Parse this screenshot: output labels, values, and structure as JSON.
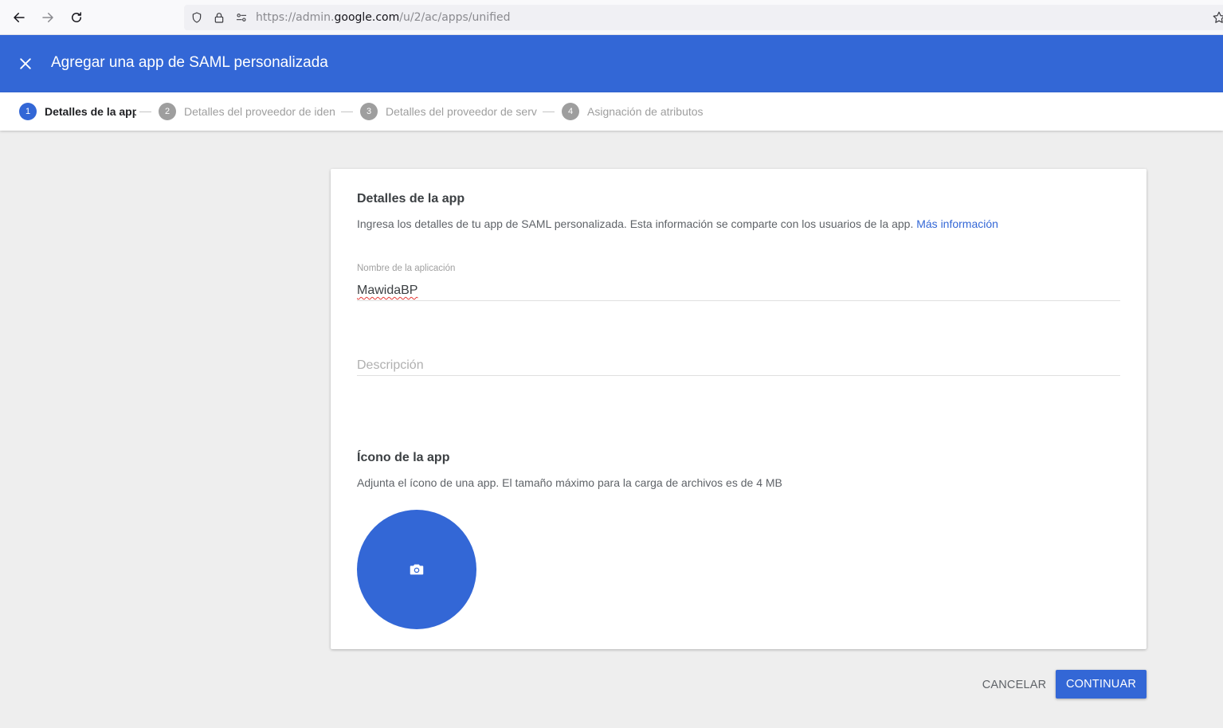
{
  "browser": {
    "url_prefix": "https://admin.",
    "url_domain": "google.com",
    "url_path": "/u/2/ac/apps/unified"
  },
  "header": {
    "title": "Agregar una app de SAML personalizada"
  },
  "stepper": {
    "steps": [
      {
        "num": "1",
        "label": "Detalles de la app",
        "active": true
      },
      {
        "num": "2",
        "label": "Detalles del proveedor de identidad",
        "active": false
      },
      {
        "num": "3",
        "label": "Detalles del proveedor de servicios",
        "active": false
      },
      {
        "num": "4",
        "label": "Asignación de atributos",
        "active": false
      }
    ]
  },
  "card": {
    "details_title": "Detalles de la app",
    "details_desc": "Ingresa los detalles de tu app de SAML personalizada. Esta información se comparte con los usuarios de la app.",
    "more_info_link": "Más información",
    "app_name_label": "Nombre de la aplicación",
    "app_name_value": "MawidaBP",
    "description_placeholder": "Descripción",
    "icon_title": "Ícono de la app",
    "icon_desc": "Adjunta el ícono de una app. El tamaño máximo para la carga de archivos es de 4 MB"
  },
  "actions": {
    "cancel_label": "CANCELAR",
    "continue_label": "CONTINUAR"
  },
  "colors": {
    "primary": "#3367d6",
    "background": "#eeeeee"
  }
}
